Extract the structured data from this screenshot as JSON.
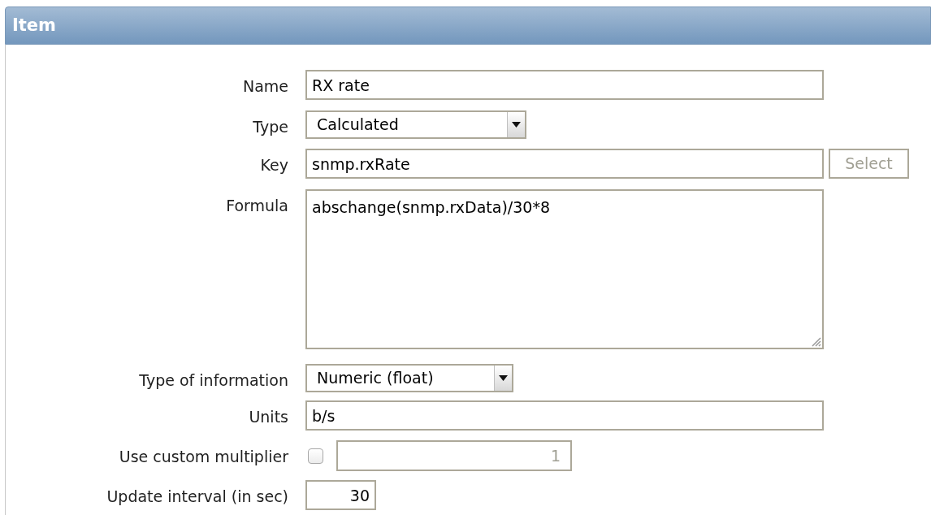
{
  "panel": {
    "title": "Item"
  },
  "fields": [
    {
      "kind": "text",
      "label": "Name",
      "value": "RX rate"
    },
    {
      "kind": "select",
      "label": "Type",
      "value": "Calculated"
    },
    {
      "kind": "text",
      "label": "Key",
      "value": "snmp.rxRate",
      "button": {
        "label": "Select",
        "disabled": true
      }
    },
    {
      "kind": "textarea",
      "label": "Formula",
      "value": "abschange(snmp.rxData)/30*8"
    },
    {
      "kind": "select",
      "label": "Type of information",
      "value": "Numeric (float)"
    },
    {
      "kind": "text",
      "label": "Units",
      "value": "b/s"
    },
    {
      "kind": "checkbox_number",
      "label": "Use custom multiplier",
      "checked": false,
      "value": "1",
      "disabled": true
    },
    {
      "kind": "number",
      "label": "Update interval (in sec)",
      "value": "30"
    }
  ]
}
